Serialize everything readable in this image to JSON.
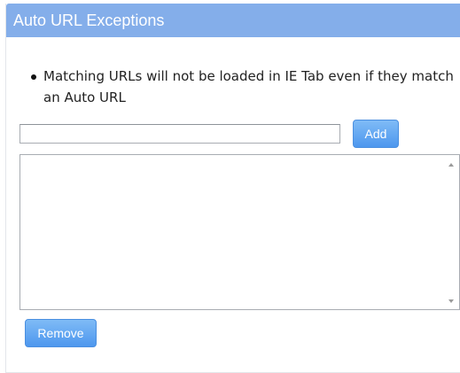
{
  "panel": {
    "title": "Auto URL Exceptions"
  },
  "info": {
    "items": [
      "Matching URLs will not be loaded in IE Tab even if they match an Auto URL"
    ]
  },
  "url_input": {
    "value": "",
    "placeholder": ""
  },
  "buttons": {
    "add_label": "Add",
    "remove_label": "Remove"
  },
  "exceptions_list": {
    "entries": []
  },
  "colors": {
    "header_background": "#84aeea",
    "button_background": "#5a9ff0",
    "header_text": "#ffffff"
  },
  "icons": {
    "list_bullet": "bullet-icon",
    "scroll_up": "scroll-up-arrow-icon",
    "scroll_down": "scroll-down-arrow-icon"
  }
}
